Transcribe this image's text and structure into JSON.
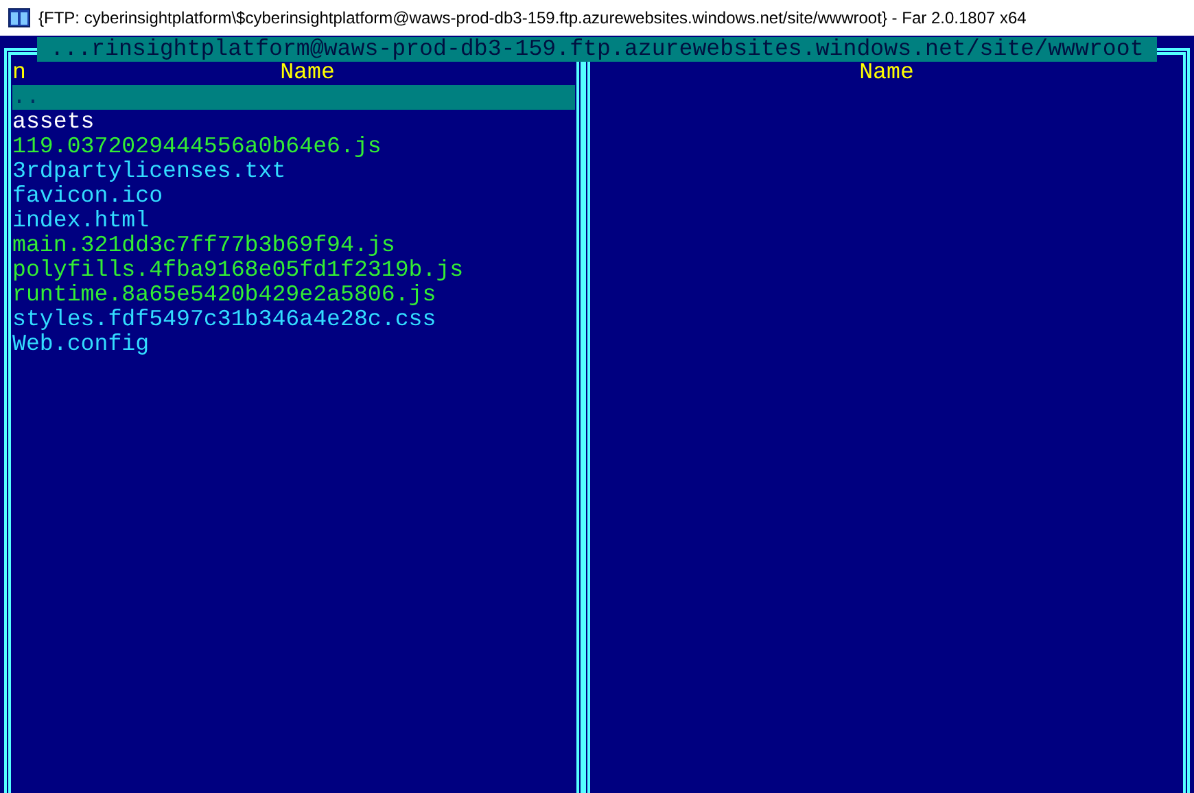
{
  "window": {
    "title": "{FTP: cyberinsightplatform\\$cyberinsightplatform@waws-prod-db3-159.ftp.azurewebsites.windows.net/site/wwwroot} - Far 2.0.1807 x64"
  },
  "left_panel": {
    "path": " ...rinsightplatform@waws-prod-db3-159.ftp.azurewebsites.windows.net/site/wwwroot ",
    "column_1": "n",
    "column_2": "Name",
    "files": [
      {
        "name": "..",
        "kind": "up",
        "selected": true
      },
      {
        "name": "assets",
        "kind": "folder",
        "selected": false
      },
      {
        "name": "119.0372029444556a0b64e6.js",
        "kind": "script",
        "selected": false
      },
      {
        "name": "3rdpartylicenses.txt",
        "kind": "file",
        "selected": false
      },
      {
        "name": "favicon.ico",
        "kind": "file",
        "selected": false
      },
      {
        "name": "index.html",
        "kind": "file",
        "selected": false
      },
      {
        "name": "main.321dd3c7ff77b3b69f94.js",
        "kind": "script",
        "selected": false
      },
      {
        "name": "polyfills.4fba9168e05fd1f2319b.js",
        "kind": "script",
        "selected": false
      },
      {
        "name": "runtime.8a65e5420b429e2a5806.js",
        "kind": "script",
        "selected": false
      },
      {
        "name": "styles.fdf5497c31b346a4e28c.css",
        "kind": "file",
        "selected": false
      },
      {
        "name": "Web.config",
        "kind": "file",
        "selected": false
      }
    ]
  },
  "right_panel": {
    "column_1": "Name"
  }
}
